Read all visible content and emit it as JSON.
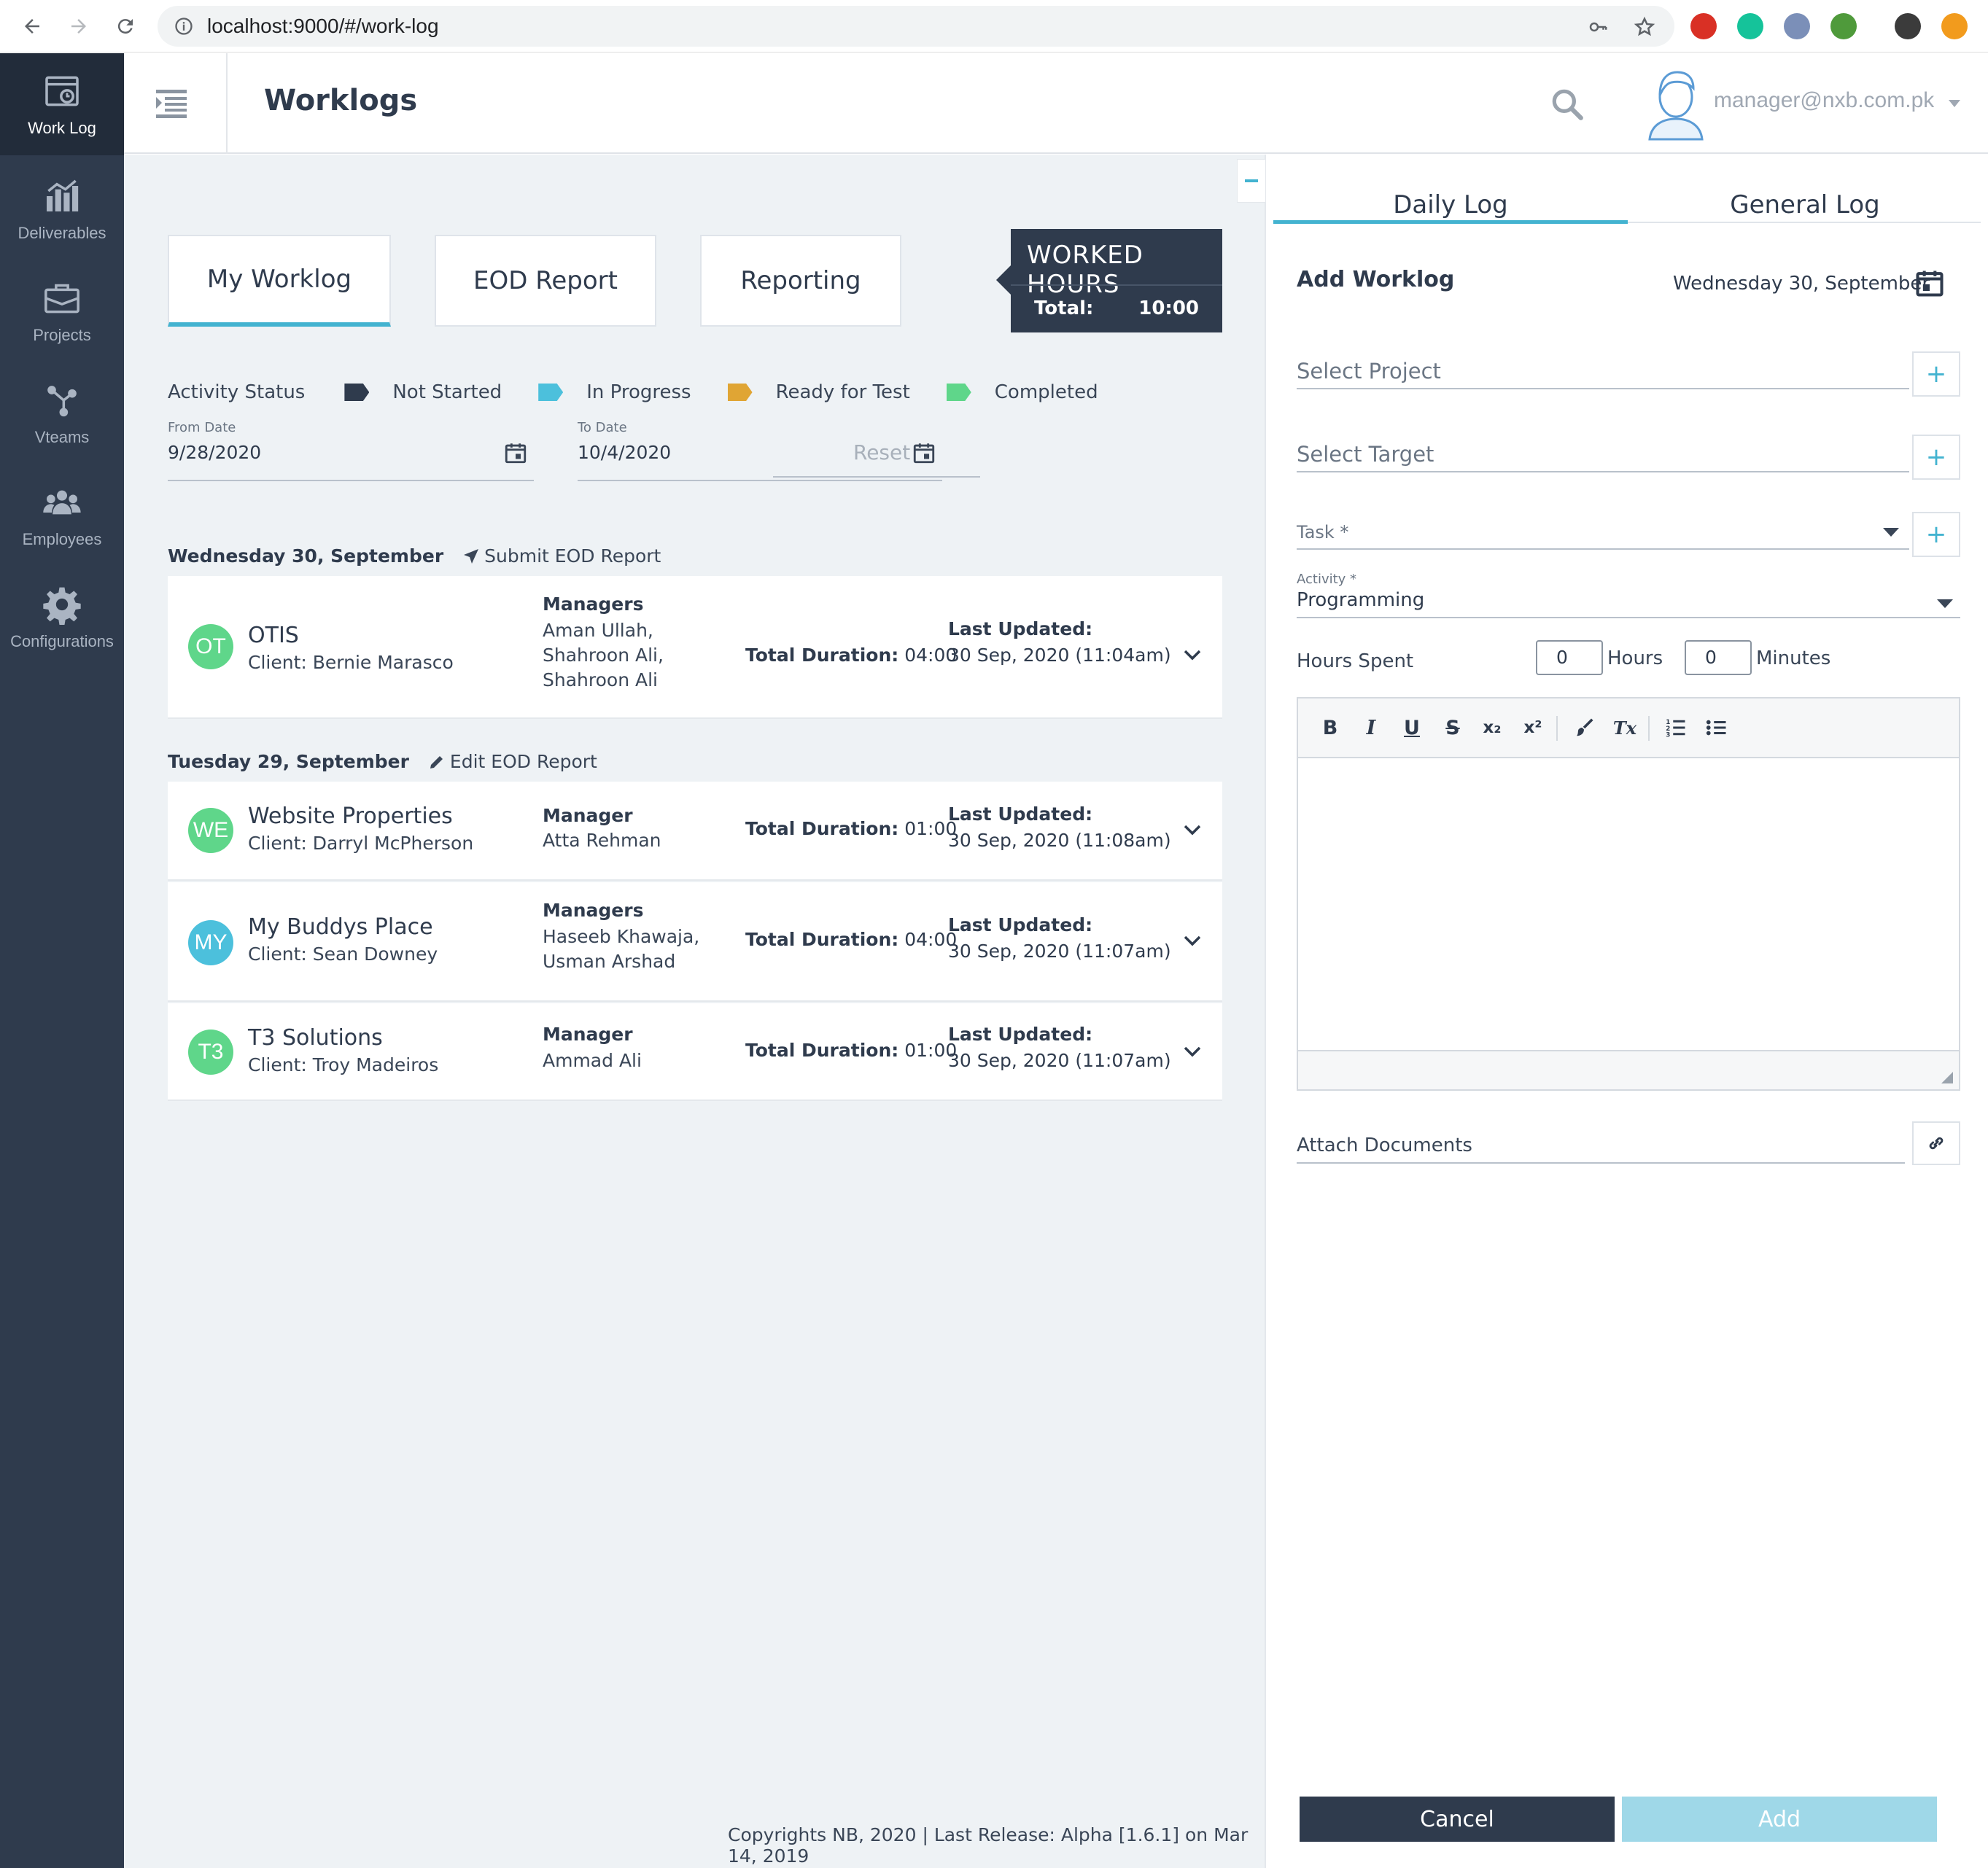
{
  "browser": {
    "url": "localhost:9000/#/work-log"
  },
  "sidebar": {
    "items": [
      {
        "label": "Work Log",
        "icon": "calendar-clock-icon"
      },
      {
        "label": "Deliverables",
        "icon": "bar-chart-icon"
      },
      {
        "label": "Projects",
        "icon": "briefcase-icon"
      },
      {
        "label": "Vteams",
        "icon": "network-icon"
      },
      {
        "label": "Employees",
        "icon": "group-icon"
      },
      {
        "label": "Configurations",
        "icon": "gear-icon"
      }
    ]
  },
  "header": {
    "title": "Worklogs",
    "user_email": "manager@nxb.com.pk"
  },
  "tabs": {
    "my_worklog": "My Worklog",
    "eod_report": "EOD Report",
    "reporting": "Reporting"
  },
  "worked_hours": {
    "title": "WORKED HOURS",
    "total_label": "Total:",
    "total_value": "10:00"
  },
  "activity_status": {
    "label": "Activity Status",
    "items": [
      {
        "label": "Not Started",
        "color": "#2f3b4d"
      },
      {
        "label": "In Progress",
        "color": "#4cc0dc"
      },
      {
        "label": "Ready for Test",
        "color": "#e0a534"
      },
      {
        "label": "Completed",
        "color": "#5fd68a"
      }
    ]
  },
  "filters": {
    "from_label": "From Date",
    "from_value": "9/28/2020",
    "to_label": "To Date",
    "to_value": "10/4/2020",
    "reset": "Reset"
  },
  "days": [
    {
      "heading": "Wednesday 30, September",
      "action": "Submit EOD Report",
      "entries": [
        {
          "initials": "OT",
          "color": "#5fd68a",
          "name": "OTIS",
          "client": "Client: Bernie Marasco",
          "manager_title": "Managers",
          "managers": [
            "Aman Ullah,",
            "Shahroon Ali,",
            "Shahroon Ali"
          ],
          "duration_label": "Total Duration:",
          "duration": "04:00",
          "updated_label": "Last Updated:",
          "updated": "30 Sep, 2020 (11:04am)"
        }
      ]
    },
    {
      "heading": "Tuesday 29, September",
      "action": "Edit EOD Report",
      "entries": [
        {
          "initials": "WE",
          "color": "#5fd68a",
          "name": "Website Properties",
          "client": "Client: Darryl McPherson",
          "manager_title": "Manager",
          "managers": [
            "Atta Rehman"
          ],
          "duration_label": "Total Duration:",
          "duration": "01:00",
          "updated_label": "Last Updated:",
          "updated": "30 Sep, 2020 (11:08am)"
        },
        {
          "initials": "MY",
          "color": "#4cc0dc",
          "name": "My Buddys Place",
          "client": "Client: Sean Downey",
          "manager_title": "Managers",
          "managers": [
            "Haseeb Khawaja,",
            "Usman Arshad"
          ],
          "duration_label": "Total Duration:",
          "duration": "04:00",
          "updated_label": "Last Updated:",
          "updated": "30 Sep, 2020 (11:07am)"
        },
        {
          "initials": "T3",
          "color": "#5fd68a",
          "name": "T3 Solutions",
          "client": "Client: Troy Madeiros",
          "manager_title": "Manager",
          "managers": [
            "Ammad Ali"
          ],
          "duration_label": "Total Duration:",
          "duration": "01:00",
          "updated_label": "Last Updated:",
          "updated": "30 Sep, 2020 (11:07am)"
        }
      ]
    }
  ],
  "footer": "Copyrights NB, 2020 | Last Release: Alpha [1.6.1] on Mar 14, 2019",
  "panel": {
    "tab_daily": "Daily Log",
    "tab_general": "General Log",
    "title": "Add Worklog",
    "date": "Wednesday 30, September",
    "select_project": "Select Project",
    "select_target": "Select Target",
    "task_label": "Task *",
    "activity_label": "Activity *",
    "activity_value": "Programming",
    "hours_spent_label": "Hours Spent",
    "hours_value": "0",
    "hours_unit": "Hours",
    "minutes_value": "0",
    "minutes_unit": "Minutes",
    "toolbar": {
      "bold": "B",
      "italic": "I",
      "underline": "U",
      "strike": "S",
      "subscript": "x₂",
      "superscript": "x²",
      "clear": "Tx"
    },
    "attach_label": "Attach Documents",
    "cancel": "Cancel",
    "add": "Add"
  },
  "colors": {
    "sidebar": "#2f3b4d",
    "accent": "#43b3d0",
    "add_button": "#9fd8e8"
  }
}
